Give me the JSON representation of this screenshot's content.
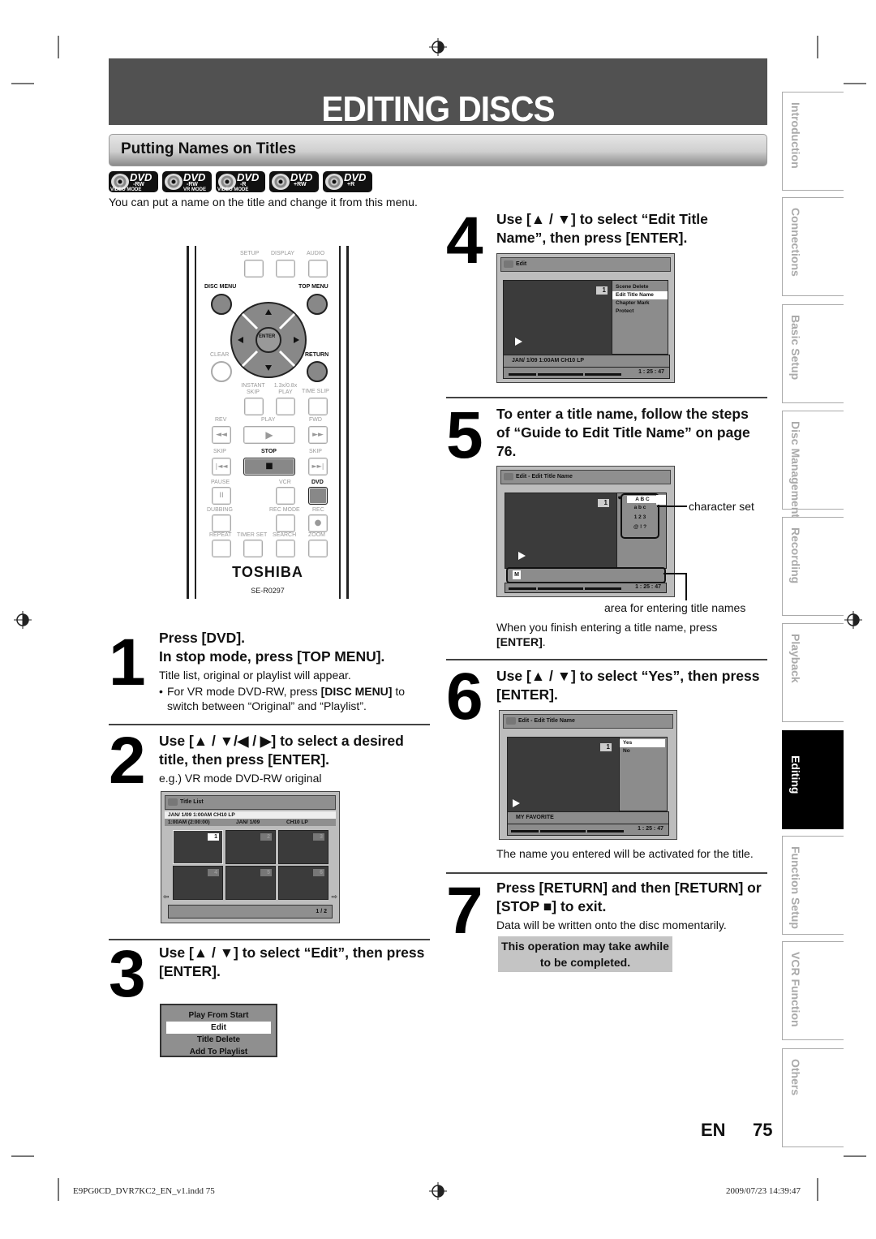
{
  "page": {
    "title": "EDITING DISCS",
    "section": "Putting Names on Titles",
    "intro": "You can put a name on the title and change it from this menu.",
    "page_lang": "EN",
    "page_number": "75"
  },
  "disc_types": [
    {
      "label": "DVD",
      "sub": "-RW",
      "mode": "VIDEO MODE"
    },
    {
      "label": "DVD",
      "sub": "-RW",
      "mode": "VR MODE"
    },
    {
      "label": "DVD",
      "sub": "-R",
      "mode": "VIDEO MODE"
    },
    {
      "label": "DVD",
      "sub": "+RW",
      "mode": ""
    },
    {
      "label": "DVD",
      "sub": "+R",
      "mode": ""
    }
  ],
  "remote": {
    "labels": {
      "setup": "SETUP",
      "display": "DISPLAY",
      "audio": "AUDIO",
      "disc_menu": "DISC MENU",
      "top_menu": "TOP MENU",
      "enter": "ENTER",
      "clear": "CLEAR",
      "return": "RETURN",
      "instant_skip": "INSTANT SKIP",
      "speed_play": "1.3x/0.8x PLAY",
      "time_slip": "TIME SLIP",
      "rev": "REV",
      "play": "PLAY",
      "fwd": "FWD",
      "skip_back": "SKIP",
      "stop": "STOP",
      "skip_fwd": "SKIP",
      "pause": "PAUSE",
      "vcr": "VCR",
      "dvd": "DVD",
      "dubbing": "DUBBING",
      "rec_mode": "REC MODE",
      "rec": "REC",
      "repeat": "REPEAT",
      "timer_set": "TIMER SET",
      "search": "SEARCH",
      "zoom": "ZOOM"
    },
    "brand": "TOSHIBA",
    "model": "SE-R0297"
  },
  "steps": [
    {
      "num": "1",
      "heading_1": "Press [DVD].",
      "heading_2": "In stop mode, press [TOP MENU].",
      "text": "Title list, original or playlist will appear.",
      "bullet_pre": "For VR mode DVD-RW, press ",
      "bullet_bold": "[DISC MENU]",
      "bullet_post": " to switch between “Original” and “Playlist”."
    },
    {
      "num": "2",
      "heading": "Use [▲ / ▼/◀ / ▶] to select a desired title, then press [ENTER].",
      "text": "e.g.) VR mode DVD-RW original"
    },
    {
      "num": "3",
      "heading": "Use [▲ / ▼] to select “Edit”, then press [ENTER]."
    },
    {
      "num": "4",
      "heading": "Use [▲ / ▼] to select “Edit Title Name”, then press [ENTER]."
    },
    {
      "num": "5",
      "heading": "To enter a title name, follow the steps of “Guide to Edit Title Name” on page 76.",
      "callout_charset": "character set",
      "callout_area": "area for entering title names",
      "after_pre": "When you finish entering a title name, press ",
      "after_bold": "[ENTER]",
      "after_post": "."
    },
    {
      "num": "6",
      "heading": "Use [▲ / ▼] to select “Yes”, then press [ENTER].",
      "text": "The name you entered will be activated for the title."
    },
    {
      "num": "7",
      "heading": "Press [RETURN] and then [RETURN] or [STOP ■] to exit.",
      "text": "Data will be written onto the disc momentarily.",
      "note": "This operation may take awhile to be completed."
    }
  ],
  "screens": {
    "title_list": {
      "header": "Title List",
      "info_row_1": "JAN/ 1/09 1:00AM  CH10   LP",
      "info_row_2_time": "1:00AM (2:00:00)",
      "info_row_2_date": "JAN/ 1/09",
      "info_row_2_ch": "CH10   LP",
      "thumbs": [
        "1",
        "2",
        "3",
        "4",
        "5",
        "6"
      ],
      "selected": "1",
      "page": "1 / 2"
    },
    "edit_menu_popup": {
      "items": [
        "Play From Start",
        "Edit",
        "Title Delete",
        "Add To Playlist"
      ],
      "selected": "Edit"
    },
    "edit": {
      "header": "Edit",
      "title_no": "1",
      "items": [
        "Scene Delete",
        "Edit Title Name",
        "Chapter Mark",
        "Protect"
      ],
      "selected": "Edit Title Name",
      "info": "JAN/ 1/09 1:00AM CH10   LP",
      "time": "1 : 25 : 47"
    },
    "edit_title_name": {
      "header": "Edit - Edit Title Name",
      "title_no": "1",
      "charset": [
        "A B C",
        "a b c",
        "1 2 3",
        "@ !  ?"
      ],
      "selected_charset": "A B C",
      "entry": "M",
      "time": "1 : 25 : 47"
    },
    "confirm": {
      "header": "Edit - Edit Title Name",
      "title_no": "1",
      "items": [
        "Yes",
        "No"
      ],
      "selected": "Yes",
      "name": "MY FAVORITE",
      "time": "1 : 25 : 47"
    }
  },
  "side_tabs": [
    {
      "label": "Introduction",
      "active": false
    },
    {
      "label": "Connections",
      "active": false
    },
    {
      "label": "Basic Setup",
      "active": false
    },
    {
      "label": "Disc Management",
      "active": false
    },
    {
      "label": "Recording",
      "active": false
    },
    {
      "label": "Playback",
      "active": false
    },
    {
      "label": "Editing",
      "active": true
    },
    {
      "label": "Function Setup",
      "active": false
    },
    {
      "label": "VCR Function",
      "active": false
    },
    {
      "label": "Others",
      "active": false
    }
  ],
  "footer": {
    "file": "E9PG0CD_DVR7KC2_EN_v1.indd   75",
    "timestamp": "2009/07/23   14:39:47"
  }
}
